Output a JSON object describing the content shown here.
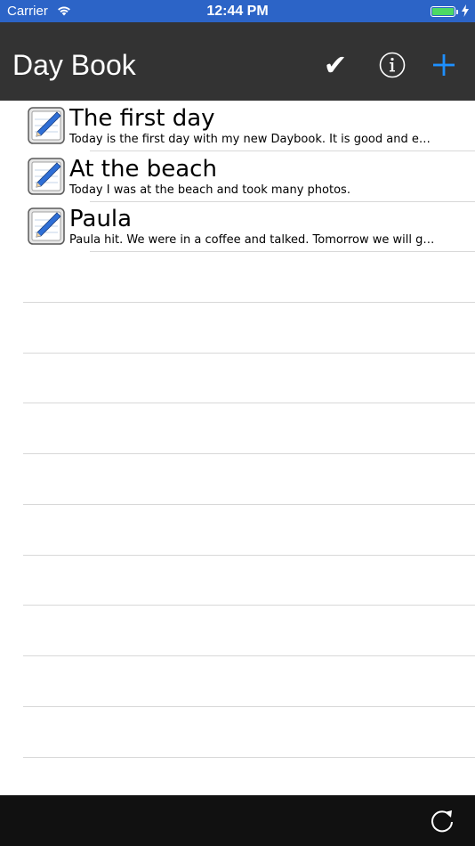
{
  "status_bar": {
    "carrier": "Carrier",
    "time": "12:44 PM",
    "battery_color": "#4cd964"
  },
  "nav": {
    "title": "Day Book",
    "done_icon": "checkmark-icon",
    "info_icon": "info-icon",
    "add_icon": "plus-icon",
    "add_color": "#1e90ff"
  },
  "entries": [
    {
      "title": "The first day",
      "snippet": "Today is the first day with my new Daybook. It is  good and easy to use."
    },
    {
      "title": "At the beach",
      "snippet": "Today I was at the beach and took many photos."
    },
    {
      "title": "Paula",
      "snippet": "Paula hit. We were in a coffee and talked. Tomorrow we will go out again."
    }
  ],
  "toolbar": {
    "refresh_icon": "refresh-icon"
  }
}
